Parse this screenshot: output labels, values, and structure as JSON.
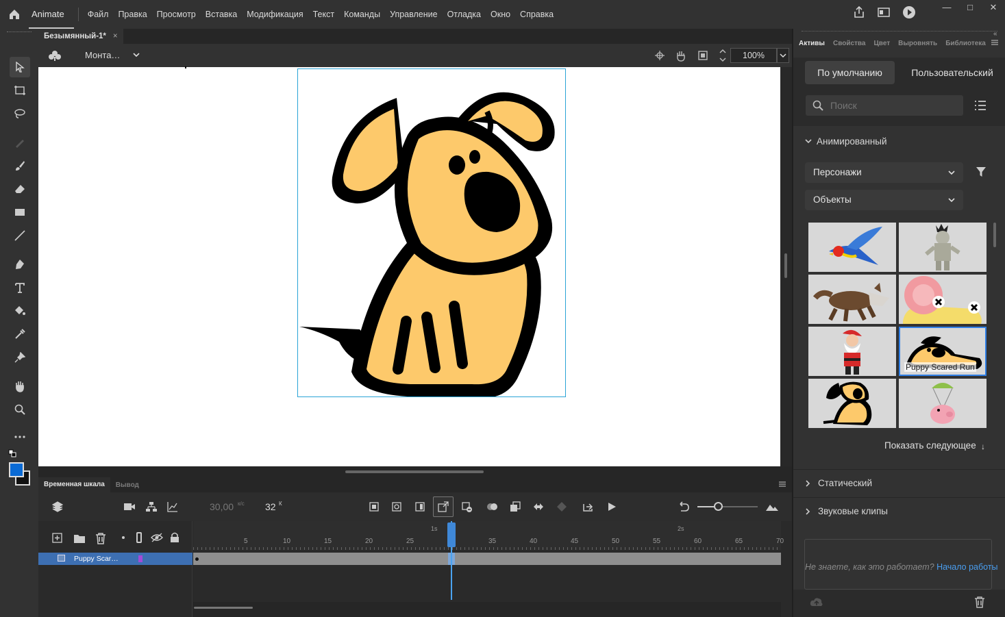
{
  "app": {
    "name": "Animate"
  },
  "menu": [
    "Файл",
    "Правка",
    "Просмотр",
    "Вставка",
    "Модификация",
    "Текст",
    "Команды",
    "Управление",
    "Отладка",
    "Окно",
    "Справка"
  ],
  "window_controls": {
    "minimize": "—",
    "maximize": "□",
    "close": "✕"
  },
  "document": {
    "tab_title": "Безымянный-1*",
    "close_glyph": "×"
  },
  "edit_bar": {
    "scene_label": "Монта…",
    "zoom": "100%"
  },
  "timeline": {
    "tabs": [
      "Временная шкала",
      "Вывод"
    ],
    "fps": "30,00",
    "fps_unit": "к/с",
    "frame": "32",
    "frame_unit": "К",
    "ruler_seconds": [
      "1s",
      "2s"
    ],
    "ruler_numbers": [
      "5",
      "10",
      "15",
      "20",
      "25",
      "30",
      "35",
      "40",
      "45",
      "50",
      "55",
      "60",
      "65",
      "70"
    ],
    "current_frame": 32,
    "layer_name": "Puppy Scar…"
  },
  "assets_panel": {
    "tabs": [
      "Активы",
      "Свойства",
      "Цвет",
      "Выровнять",
      "Библиотека"
    ],
    "toggle_default": "По умолчанию",
    "toggle_custom": "Пользовательский",
    "search_placeholder": "Поиск",
    "section_animated": "Анимированный",
    "dropdown_characters": "Персонажи",
    "dropdown_objects": "Объекты",
    "thumbnails": [
      "parrot",
      "mummy",
      "wolf",
      "snail",
      "santa",
      "Puppy Scared Run",
      "puppy",
      "pig"
    ],
    "selected_caption": "Puppy Scared Run",
    "show_more": "Показать следующее",
    "section_static": "Статический",
    "section_sound": "Звуковые клипы",
    "help_text": "Не знаете, как это работает?",
    "help_link": "Начало работы"
  },
  "colors": {
    "stroke": "#0a6ad4",
    "accent": "#3f88d8",
    "link": "#4a9ef0",
    "puppy_fill": "#fdc96b"
  }
}
